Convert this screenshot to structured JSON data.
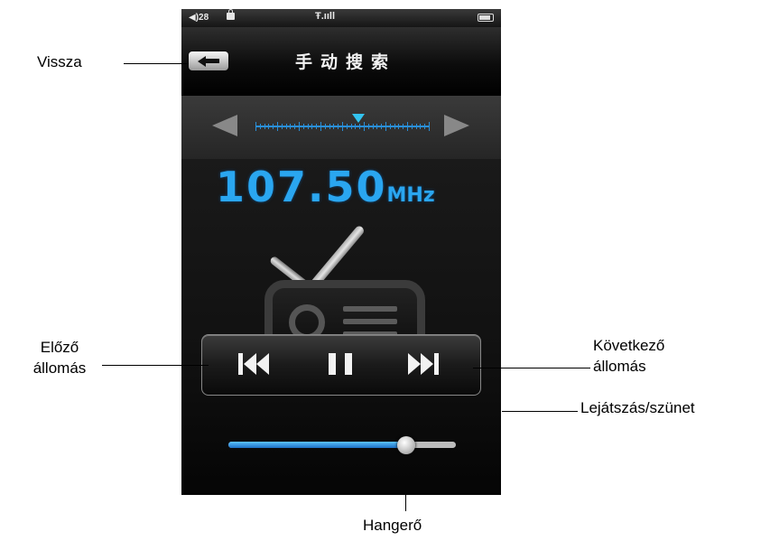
{
  "phone": {
    "status": {
      "volume": "◀)28",
      "signal": "Ŧ.ııll"
    },
    "header": {
      "title": "手动搜索"
    },
    "tuner": {
      "frequency": "107.50",
      "unit": "MHz"
    },
    "volume_level": 0.78
  },
  "annotations": {
    "back": "Vissza",
    "prev_line1": "Előző",
    "prev_line2": "állomás",
    "next_line1": "Következő",
    "next_line2": "állomás",
    "play_pause": "Lejátszás/szünet",
    "volume": "Hangerő"
  },
  "colors": {
    "accent": "#2aa6f0",
    "marker": "#33c3ef",
    "volume_fill": "#1d6fc4"
  },
  "icons": [
    "back-arrow-icon",
    "previous-track-icon",
    "pause-icon",
    "next-track-icon",
    "radio-icon"
  ]
}
